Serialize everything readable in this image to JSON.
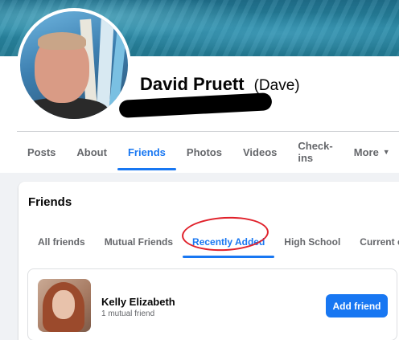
{
  "profile": {
    "name": "David Pruett",
    "nickname": "(Dave)"
  },
  "nav": {
    "tabs": [
      {
        "label": "Posts"
      },
      {
        "label": "About"
      },
      {
        "label": "Friends",
        "active": true
      },
      {
        "label": "Photos"
      },
      {
        "label": "Videos"
      },
      {
        "label": "Check-ins"
      },
      {
        "label": "More",
        "icon": "caret-down-icon"
      }
    ],
    "more_caret": "▼"
  },
  "friends_section": {
    "title": "Friends",
    "subtabs": [
      {
        "label": "All friends"
      },
      {
        "label": "Mutual Friends"
      },
      {
        "label": "Recently Added",
        "active": true
      },
      {
        "label": "High School"
      },
      {
        "label": "Current cit"
      }
    ],
    "friend": {
      "name": "Kelly Elizabeth",
      "mutual": "1 mutual friend",
      "button_label": "Add friend"
    }
  },
  "colors": {
    "accent": "#1877f2",
    "annotation": "#e0202a"
  }
}
